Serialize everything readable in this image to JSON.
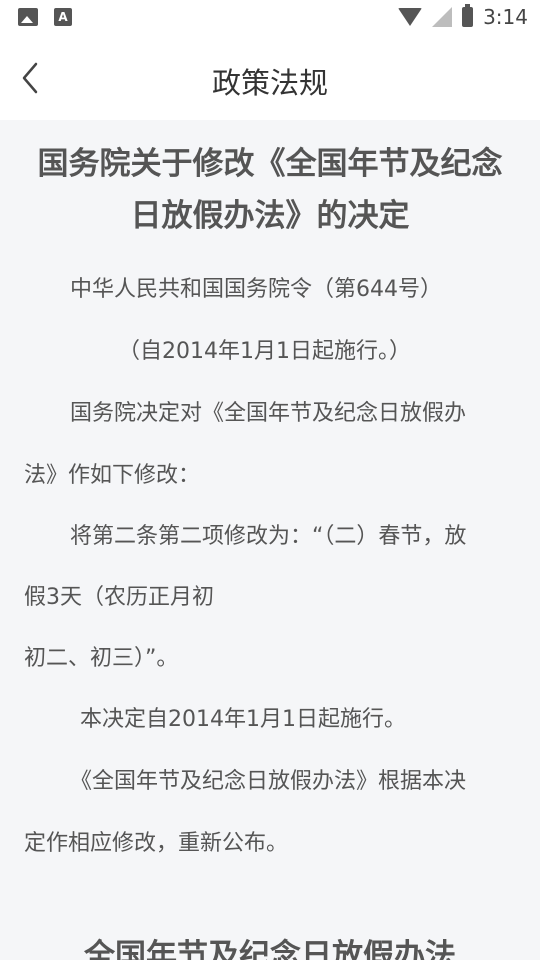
{
  "status_bar": {
    "time": "3:14",
    "icons": [
      "image-icon",
      "a-icon",
      "wifi-icon",
      "no-signal-icon",
      "battery-charging-icon"
    ]
  },
  "header": {
    "title": "政策法规",
    "back_icon": "chevron-left-icon"
  },
  "article": {
    "title_line1": "国务院关于修改《全国年节及纪念",
    "title_line2": "日放假办法》的决定",
    "lines": [
      "中华人民共和国国务院令（第644号）",
      "（自2014年1月1日起施行。）",
      "国务院决定对《全国年节及纪念日放假办",
      "法》作如下修改：",
      "将第二条第二项修改为：“（二）春节，放",
      "假3天（农历正月初",
      "初二、初三）”。",
      "本决定自2014年1月1日起施行。",
      "《全国年节及纪念日放假办法》根据本决",
      "定作相应修改，重新公布。"
    ],
    "second_title": "全国年节及纪念日放假办法"
  }
}
